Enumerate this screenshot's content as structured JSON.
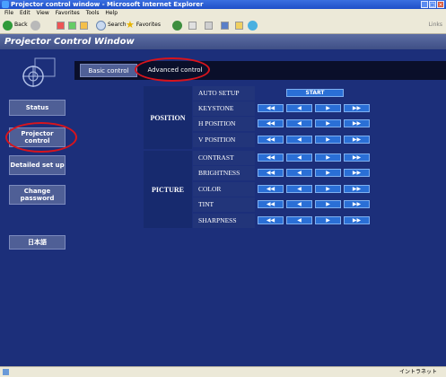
{
  "window": {
    "title": "Projector control window - Microsoft Internet Explorer"
  },
  "menu": [
    "File",
    "Edit",
    "View",
    "Favorites",
    "Tools",
    "Help"
  ],
  "toolbar": {
    "back": "Back",
    "search": "Search",
    "favorites": "Favorites",
    "links": "Links"
  },
  "app_title": "Projector Control Window",
  "sidebar": {
    "status": "Status",
    "projector_control": "Projector control",
    "detailed_setup": "Detailed set up",
    "change_password": "Change password",
    "language": "日本語"
  },
  "tabs": {
    "basic": "Basic control",
    "advanced": "Advanced control"
  },
  "groups": {
    "position": "POSITION",
    "picture": "PICTURE"
  },
  "rows": {
    "auto_setup": "AUTO SETUP",
    "keystone": "KEYSTONE",
    "h_position": "H POSITION",
    "v_position": "V POSITION",
    "contrast": "CONTRAST",
    "brightness": "BRIGHTNESS",
    "color": "COLOR",
    "tint": "TINT",
    "sharpness": "SHARPNESS"
  },
  "buttons": {
    "start": "START",
    "fast_left": "◀◀",
    "left": "◀",
    "right": "▶",
    "fast_right": "▶▶"
  },
  "status_bar": {
    "zone": "イントラネット"
  }
}
